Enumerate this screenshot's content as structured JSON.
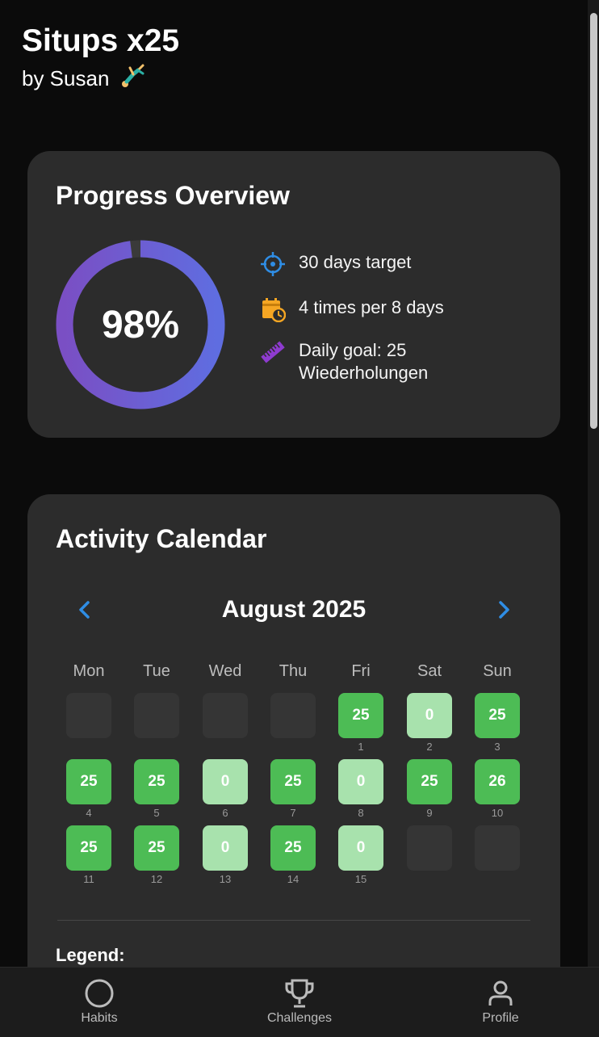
{
  "header": {
    "title": "Situps x25",
    "subtitle": "by Susan"
  },
  "progress": {
    "title": "Progress Overview",
    "percent_label": "98%",
    "percent_value": 0.98,
    "stats": [
      {
        "icon": "crosshair-icon",
        "text": "30 days target",
        "color": "#2f8de4"
      },
      {
        "icon": "calendar-clock-icon",
        "text": "4 times per 8 days",
        "color": "#f5a623"
      },
      {
        "icon": "ruler-icon",
        "text": "Daily goal: 25 Wiederholungen",
        "color": "#8e3bcf"
      }
    ],
    "ring_colors": [
      "#7a4fc4",
      "#5f6de0"
    ]
  },
  "calendar": {
    "title": "Activity Calendar",
    "month": "August 2025",
    "weekdays": [
      "Mon",
      "Tue",
      "Wed",
      "Thu",
      "Fri",
      "Sat",
      "Sun"
    ],
    "days": [
      {
        "day": "1",
        "value": "25",
        "status": "full"
      },
      {
        "day": "2",
        "value": "0",
        "status": "zero"
      },
      {
        "day": "3",
        "value": "25",
        "status": "full"
      },
      {
        "day": "4",
        "value": "25",
        "status": "full"
      },
      {
        "day": "5",
        "value": "25",
        "status": "full"
      },
      {
        "day": "6",
        "value": "0",
        "status": "zero"
      },
      {
        "day": "7",
        "value": "25",
        "status": "full"
      },
      {
        "day": "8",
        "value": "0",
        "status": "zero"
      },
      {
        "day": "9",
        "value": "25",
        "status": "full"
      },
      {
        "day": "10",
        "value": "26",
        "status": "full"
      },
      {
        "day": "11",
        "value": "25",
        "status": "full"
      },
      {
        "day": "12",
        "value": "25",
        "status": "full"
      },
      {
        "day": "13",
        "value": "0",
        "status": "zero"
      },
      {
        "day": "14",
        "value": "25",
        "status": "full"
      },
      {
        "day": "15",
        "value": "0",
        "status": "zero"
      }
    ],
    "legend_title": "Legend:"
  },
  "bottom_nav": [
    {
      "label": "Habits",
      "icon": "circle-icon"
    },
    {
      "label": "Challenges",
      "icon": "trophy-icon"
    },
    {
      "label": "Profile",
      "icon": "person-icon"
    }
  ]
}
